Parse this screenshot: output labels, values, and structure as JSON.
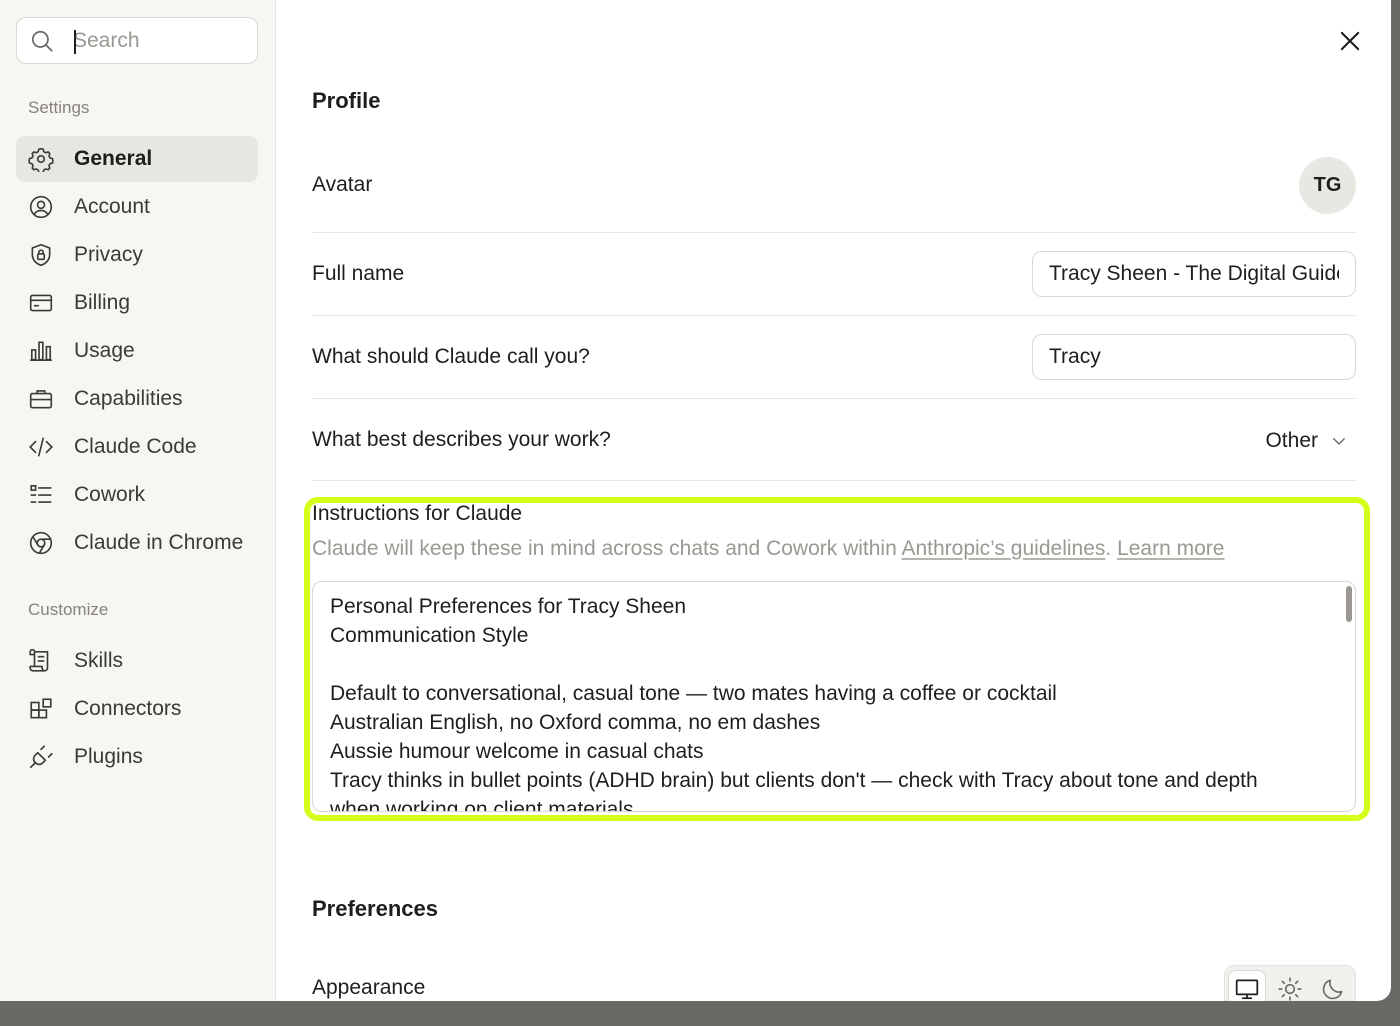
{
  "search": {
    "placeholder": "Search"
  },
  "sidebar": {
    "settings_label": "Settings",
    "customize_label": "Customize",
    "items": [
      {
        "label": "General",
        "icon": "gear-icon",
        "active": true
      },
      {
        "label": "Account",
        "icon": "user-circle-icon"
      },
      {
        "label": "Privacy",
        "icon": "shield-lock-icon"
      },
      {
        "label": "Billing",
        "icon": "credit-card-icon"
      },
      {
        "label": "Usage",
        "icon": "bar-chart-icon"
      },
      {
        "label": "Capabilities",
        "icon": "briefcase-icon"
      },
      {
        "label": "Claude Code",
        "icon": "code-icon"
      },
      {
        "label": "Cowork",
        "icon": "list-check-icon"
      },
      {
        "label": "Claude in Chrome",
        "icon": "globe-icon"
      }
    ],
    "customize_items": [
      {
        "label": "Skills",
        "icon": "scroll-icon"
      },
      {
        "label": "Connectors",
        "icon": "blocks-icon"
      },
      {
        "label": "Plugins",
        "icon": "plug-icon"
      }
    ]
  },
  "profile": {
    "heading": "Profile",
    "avatar_label": "Avatar",
    "avatar_initials": "TG",
    "fullname_label": "Full name",
    "fullname_value": "Tracy Sheen - The Digital Guide",
    "callname_label": "What should Claude call you?",
    "callname_value": "Tracy",
    "work_label": "What best describes your work?",
    "work_value": "Other"
  },
  "instructions": {
    "title": "Instructions for Claude",
    "subtitle_prefix": "Claude will keep these in mind across chats and Cowork within ",
    "guidelines_link": "Anthropic’s guidelines",
    "subtitle_dot": ".",
    "learn_more": "Learn more",
    "lines": [
      "Personal Preferences for Tracy Sheen",
      "Communication Style",
      "",
      "Default to conversational, casual tone — two mates having a coffee or cocktail",
      "Australian English, no Oxford comma, no em dashes",
      "Aussie humour welcome in casual chats",
      "Tracy thinks in bullet points (ADHD brain) but clients don't — check with Tracy about tone and depth",
      "when working on client materials"
    ],
    "highlight_color": "#d4ff1a"
  },
  "preferences": {
    "heading": "Preferences",
    "appearance_label": "Appearance",
    "appearance_options": [
      "monitor-icon",
      "sun-icon",
      "moon-icon"
    ],
    "appearance_selected": "monitor-icon"
  }
}
